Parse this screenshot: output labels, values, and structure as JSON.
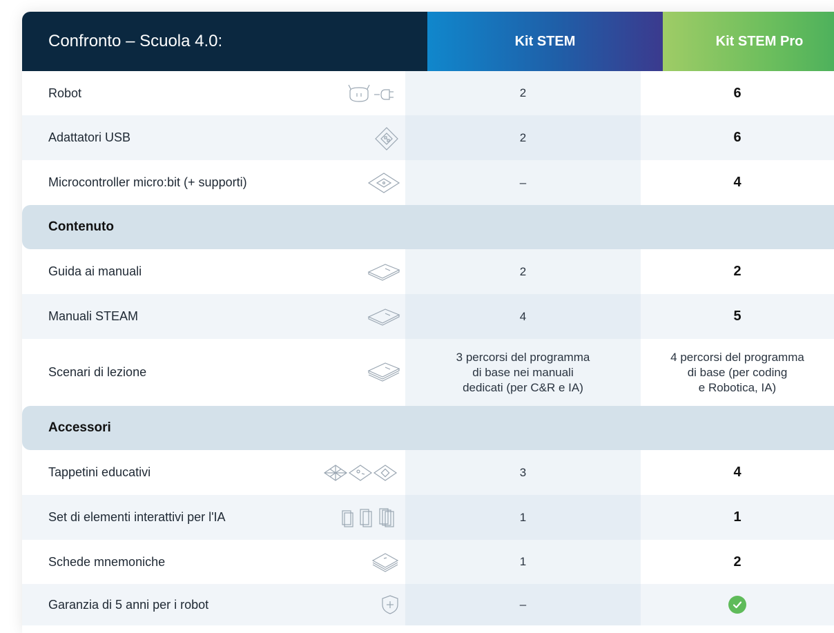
{
  "header": {
    "title": "Confronto – Scuola 4.0:",
    "col1": "Kit STEM",
    "col2": "Kit STEM Pro"
  },
  "rows": [
    {
      "label": "Robot",
      "icon": "robot-icon",
      "v1": "2",
      "v2": "6"
    },
    {
      "label": "Adattatori USB",
      "icon": "usb-adapter-icon",
      "v1": "2",
      "v2": "6"
    },
    {
      "label": "Microcontroller micro:bit (+ supporti)",
      "icon": "microcontroller-icon",
      "v1": "–",
      "v2": "4"
    },
    {
      "label": "Guida ai manuali",
      "icon": "book-icon",
      "v1": "2",
      "v2": "2"
    },
    {
      "label": "Manuali STEAM",
      "icon": "book-icon",
      "v1": "4",
      "v2": "5"
    },
    {
      "label": "Scenari di lezione",
      "icon": "book-stack-icon",
      "v1": "3 percorsi del programma di base nei manuali dedicati (per C&R e IA)",
      "v1_lines": [
        "3 percorsi del programma",
        "di base nei manuali",
        "dedicati (per C&R e IA)"
      ],
      "v2": "4 percorsi del programma di base (per coding e Robotica, IA)",
      "v2_lines": [
        "4 percorsi del programma",
        "di base (per coding",
        "e Robotica, IA)"
      ]
    },
    {
      "label": "Tappetini educativi",
      "icon": "mats-icon",
      "v1": "3",
      "v2": "4"
    },
    {
      "label": "Set di elementi interattivi per l'IA",
      "icon": "cards-icon",
      "v1": "1",
      "v2": "1"
    },
    {
      "label": "Schede mnemoniche",
      "icon": "flashcards-icon",
      "v1": "1",
      "v2": "2"
    },
    {
      "label": "Garanzia di 5 anni per i robot",
      "icon": "shield-icon",
      "v1": "–",
      "v2": "check-icon"
    }
  ],
  "sections": {
    "content": "Contenuto",
    "accessories": "Accessori"
  },
  "colors": {
    "header_dark": "#0b2840",
    "stem_blue": "#1087cc",
    "pro_green": "#6cbe5d",
    "section_bg": "#d4e1ea",
    "check_green": "#5fbb5a"
  }
}
